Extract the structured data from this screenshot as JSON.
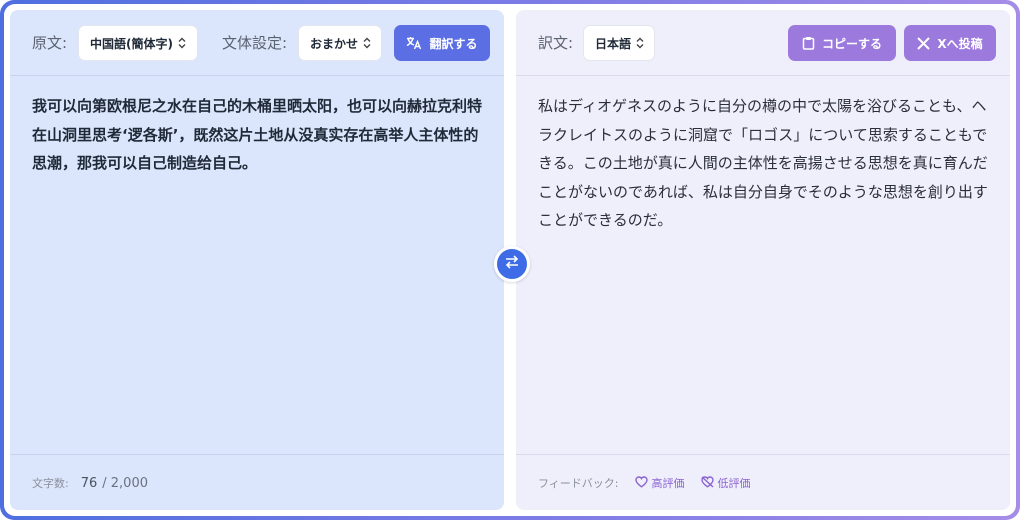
{
  "source": {
    "label": "原文:",
    "language": "中国語(簡体字)",
    "style_label": "文体設定:",
    "style_value": "おまかせ",
    "translate_label": "翻訳する",
    "text": "我可以向第欧根尼之水在自己的木桶里晒太阳，也可以向赫拉克利特在山洞里思考‘逻各斯’，既然这片土地从没真实存在高举人主体性的思潮，那我可以自己制造给自己。",
    "char_count_label": "文字数:",
    "char_count": "76",
    "char_limit": "/ 2,000"
  },
  "target": {
    "label": "訳文:",
    "language": "日本語",
    "copy_label": "コピーする",
    "post_label": "Xへ投稿",
    "text": "私はディオゲネスのように自分の樽の中で太陽を浴びることも、ヘラクレイトスのように洞窟で「ロゴス」について思索することもできる。この土地が真に人間の主体性を高揚させる思想を真に育んだことがないのであれば、私は自分自身でそのような思想を創り出すことができるのだ。",
    "feedback_label": "フィードバック:",
    "good_label": "高評価",
    "bad_label": "低評価"
  },
  "icons": {
    "translate": "translate-icon",
    "copy": "clipboard-icon",
    "post": "x-logo-icon",
    "swap": "swap-arrows-icon",
    "good": "heart-icon",
    "bad": "heart-off-icon",
    "chevron": "chevron-up-down-icon"
  },
  "colors": {
    "primary": "#5b6ee3",
    "accent": "#9b79dd",
    "swap": "#3d6ce6",
    "source_bg": "#dbe5fb",
    "target_bg": "#efeefb"
  }
}
